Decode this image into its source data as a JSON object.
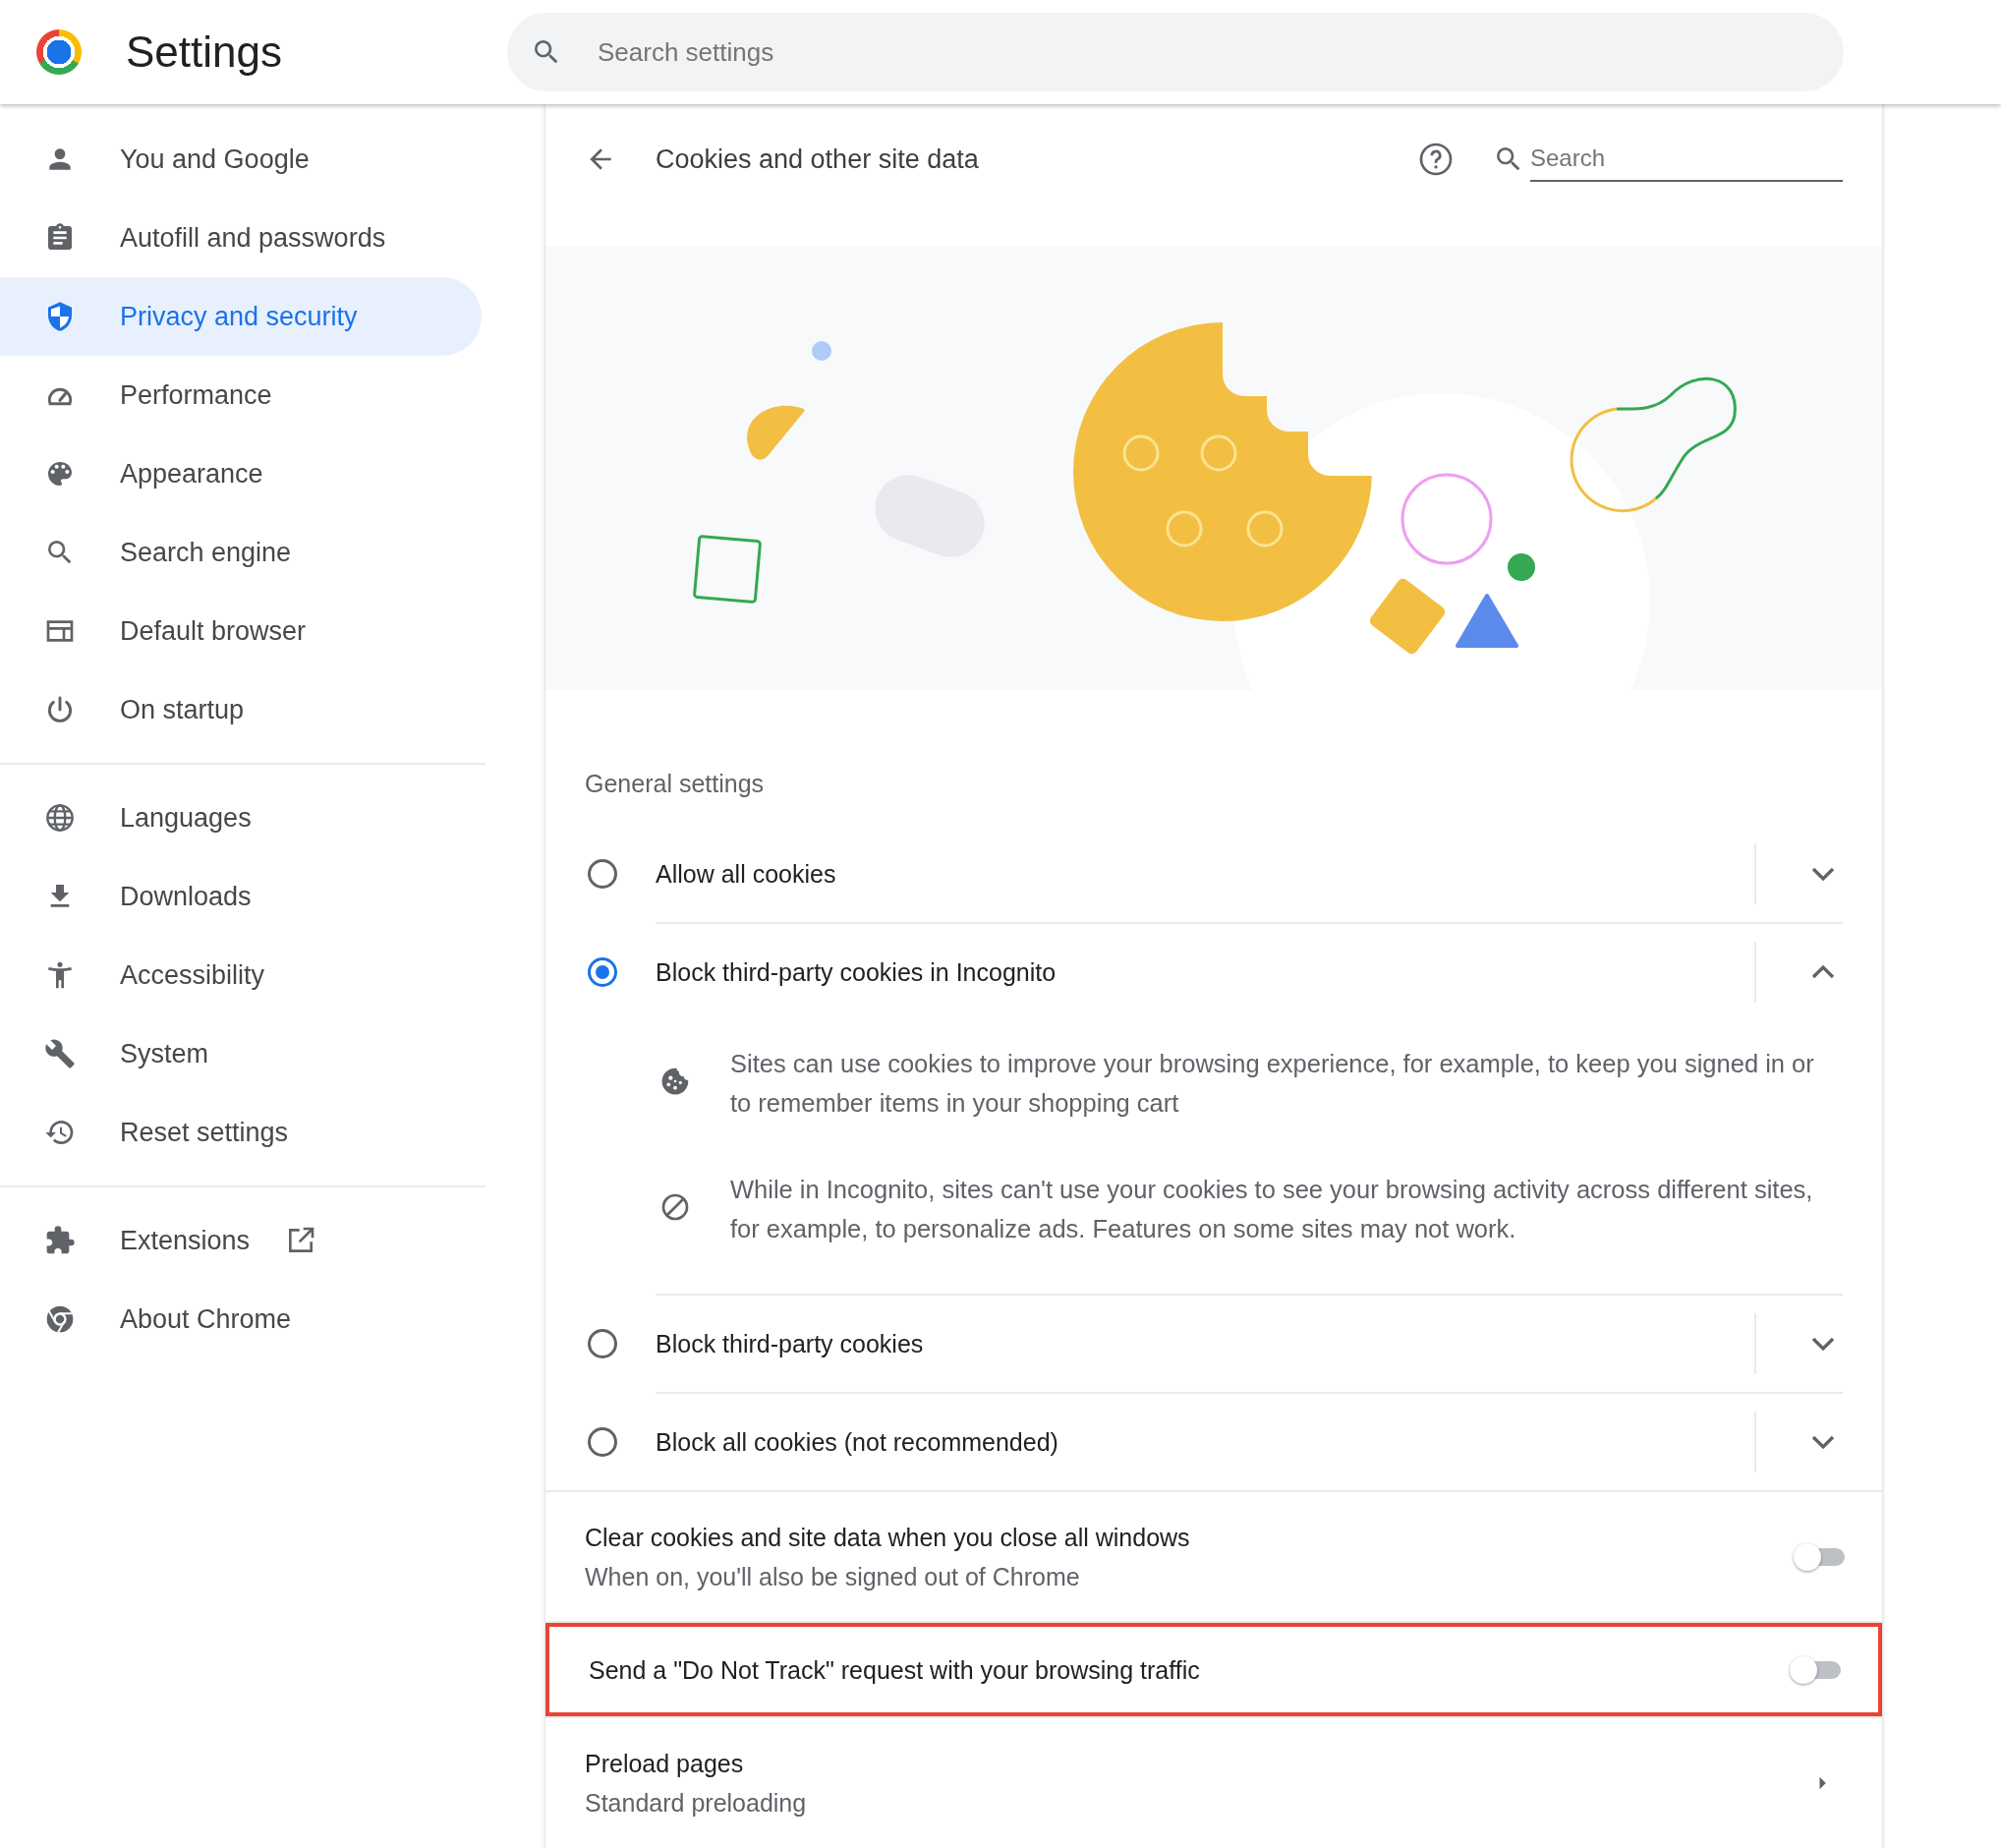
{
  "header": {
    "title": "Settings",
    "search": {
      "placeholder": "Search settings"
    }
  },
  "sidebar": {
    "groups": [
      {
        "items": [
          {
            "label": "You and Google",
            "selected": false
          },
          {
            "label": "Autofill and passwords",
            "selected": false
          },
          {
            "label": "Privacy and security",
            "selected": true
          },
          {
            "label": "Performance",
            "selected": false
          },
          {
            "label": "Appearance",
            "selected": false
          },
          {
            "label": "Search engine",
            "selected": false
          },
          {
            "label": "Default browser",
            "selected": false
          },
          {
            "label": "On startup",
            "selected": false
          }
        ]
      },
      {
        "items": [
          {
            "label": "Languages",
            "selected": false
          },
          {
            "label": "Downloads",
            "selected": false
          },
          {
            "label": "Accessibility",
            "selected": false
          },
          {
            "label": "System",
            "selected": false
          },
          {
            "label": "Reset settings",
            "selected": false
          }
        ]
      },
      {
        "items": [
          {
            "label": "Extensions",
            "selected": false,
            "external_link": true
          },
          {
            "label": "About Chrome",
            "selected": false
          }
        ]
      }
    ]
  },
  "page": {
    "title": "Cookies and other site data",
    "search": {
      "placeholder": "Search"
    }
  },
  "general_settings": {
    "heading": "General settings",
    "options": [
      {
        "label": "Allow all cookies",
        "selected": false,
        "expanded": false
      },
      {
        "label": "Block third-party cookies in Incognito",
        "selected": true,
        "expanded": true,
        "details": [
          {
            "kind": "cookie",
            "text": "Sites can use cookies to improve your browsing experience, for example, to keep you signed in or to remember items in your shopping cart"
          },
          {
            "kind": "blocked",
            "text": "While in Incognito, sites can't use your cookies to see your browsing activity across different sites, for example, to personalize ads. Features on some sites may not work."
          }
        ]
      },
      {
        "label": "Block third-party cookies",
        "selected": false,
        "expanded": false
      },
      {
        "label": "Block all cookies (not recommended)",
        "selected": false,
        "expanded": false
      }
    ]
  },
  "toggles": [
    {
      "label": "Clear cookies and site data when you close all windows",
      "sublabel": "When on, you'll also be signed out of Chrome",
      "on": false,
      "highlighted": false
    },
    {
      "label": "Send a \"Do Not Track\" request with your browsing traffic",
      "on": false,
      "highlighted": true
    }
  ],
  "links": [
    {
      "label": "Preload pages",
      "sublabel": "Standard preloading"
    }
  ]
}
